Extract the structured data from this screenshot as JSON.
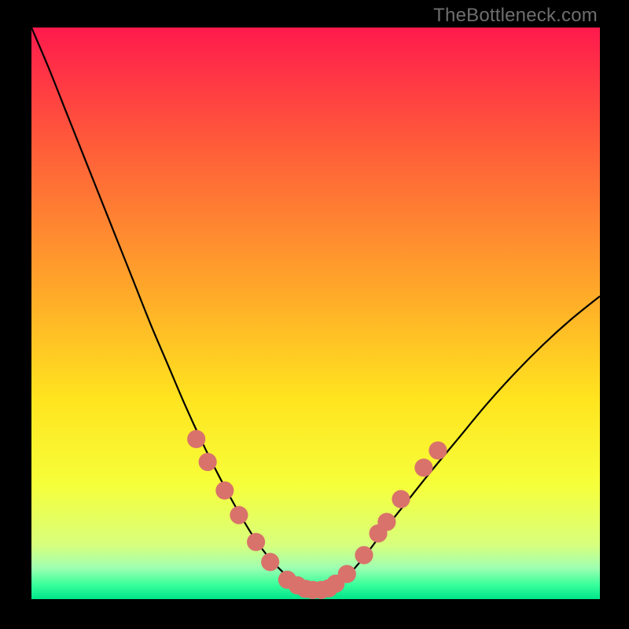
{
  "watermark": "TheBottleneck.com",
  "chart_data": {
    "type": "line",
    "title": "",
    "xlabel": "",
    "ylabel": "",
    "xlim": [
      0,
      100
    ],
    "ylim": [
      0,
      100
    ],
    "grid": false,
    "legend": false,
    "background": {
      "type": "vertical-gradient",
      "stops": [
        {
          "offset": 0.0,
          "color": "#ff1a4d"
        },
        {
          "offset": 0.2,
          "color": "#ff5a3a"
        },
        {
          "offset": 0.45,
          "color": "#ffa52a"
        },
        {
          "offset": 0.65,
          "color": "#ffe41f"
        },
        {
          "offset": 0.8,
          "color": "#f6ff3a"
        },
        {
          "offset": 0.905,
          "color": "#d8ff7d"
        },
        {
          "offset": 0.945,
          "color": "#9fffb1"
        },
        {
          "offset": 0.975,
          "color": "#38ff9b"
        },
        {
          "offset": 1.0,
          "color": "#00e58a"
        }
      ]
    },
    "series": [
      {
        "name": "bottleneck-curve",
        "color": "#000000",
        "x": [
          0,
          3,
          6,
          9,
          12,
          15,
          18,
          21,
          24,
          27,
          30,
          33,
          36,
          39,
          42,
          45,
          47,
          49,
          51,
          53,
          56,
          59,
          62,
          66,
          70,
          75,
          80,
          85,
          90,
          95,
          100
        ],
        "values": [
          100,
          93,
          85.5,
          78,
          70.5,
          63,
          55.5,
          48,
          41,
          34,
          27.5,
          21.5,
          16,
          11,
          7,
          4,
          2.3,
          1.5,
          1.5,
          2.2,
          4.5,
          8,
          12,
          17,
          22,
          28,
          34,
          39.5,
          44.5,
          49,
          53
        ]
      }
    ],
    "markers": {
      "name": "highlight-dots",
      "color": "#d9726b",
      "radius": 1.6,
      "points": [
        {
          "x": 29,
          "y": 28
        },
        {
          "x": 31,
          "y": 24
        },
        {
          "x": 34,
          "y": 19
        },
        {
          "x": 36.5,
          "y": 14.7
        },
        {
          "x": 39.5,
          "y": 10
        },
        {
          "x": 42,
          "y": 6.5
        },
        {
          "x": 45,
          "y": 3.4
        },
        {
          "x": 46.8,
          "y": 2.4
        },
        {
          "x": 48.2,
          "y": 1.8
        },
        {
          "x": 49.5,
          "y": 1.6
        },
        {
          "x": 51,
          "y": 1.6
        },
        {
          "x": 52.3,
          "y": 1.9
        },
        {
          "x": 53.5,
          "y": 2.7
        },
        {
          "x": 55.5,
          "y": 4.4
        },
        {
          "x": 58.5,
          "y": 7.7
        },
        {
          "x": 61,
          "y": 11.5
        },
        {
          "x": 62.5,
          "y": 13.5
        },
        {
          "x": 65,
          "y": 17.5
        },
        {
          "x": 69,
          "y": 23
        },
        {
          "x": 71.5,
          "y": 26
        }
      ]
    }
  }
}
